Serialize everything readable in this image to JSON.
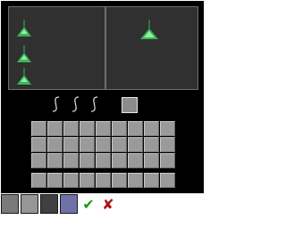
{
  "colors": {
    "window_bg": "#000000",
    "preview_bg": "#303030",
    "tree_leaf": "#3cb45a",
    "tree_leaf_light": "#8ef0a0",
    "slot_fill": "#9a9a9a",
    "swatches": [
      "#7a7a7a",
      "#969696",
      "#404040",
      "#6f72a8"
    ],
    "confirm": "#1a9a1a",
    "cancel": "#b01010"
  },
  "icons": {
    "confirm": "✔",
    "cancel": "✘"
  }
}
